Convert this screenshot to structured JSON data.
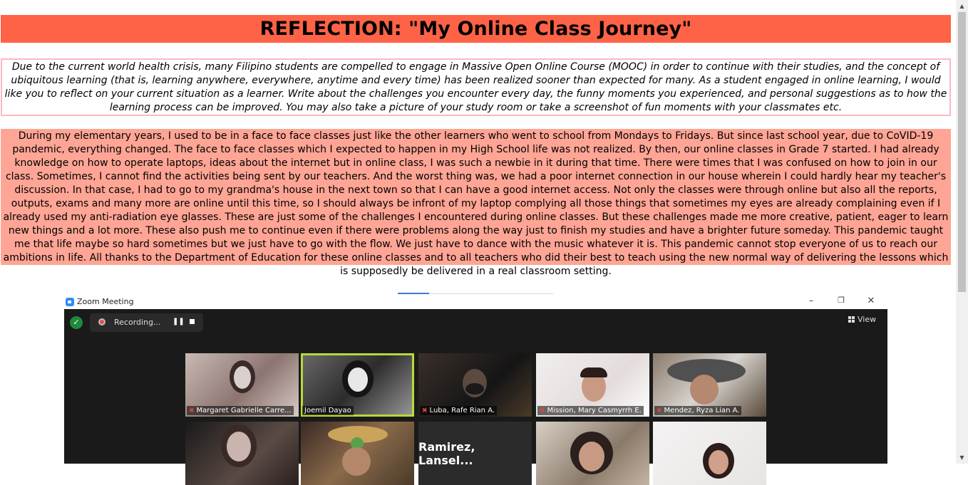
{
  "title": "REFLECTION: \"My Online Class Journey\"",
  "prompt": "Due to the current world health crisis, many Filipino students are compelled to engage in Massive Open Online Course (MOOC) in order to continue with their studies, and the concept of ubiquitous learning (that is, learning anywhere, everywhere, anytime and every time) has been realized sooner than expected for many. As a student engaged in online learning, I would like you to reflect on your current situation as a learner. Write about the challenges you encounter every day, the funny moments you experienced, and personal suggestions as to how the learning process can be improved. You may also take a picture of your study room or take a screenshot of fun moments with your classmates etc.",
  "response": "During my elementary years, I used to be in a face to face classes just like the other learners who went to school from Mondays to Fridays. But since last school year, due to CoVID-19 pandemic, everything changed. The face to face classes which I expected to happen in my High School life was not realized. By then, our online classes in Grade 7 started. I had already knowledge on how to operate laptops, ideas about the internet but in online class, I was such a newbie in it during that time. There were times that I was confused on how to join in our class. Sometimes, I cannot find the activities being sent by our teachers. And the worst thing was, we had a poor internet connection in our house wherein I could hardly hear my teacher's discussion. In that case, I had to go to my grandma's house in the next town so that I can have a good internet access. Not only the classes were through online but also all the reports, outputs, exams and many more are online until this time, so I should always be infront of my laptop complying all those things that sometimes my eyes are already complaining even if I already used my anti-radiation eye glasses. These are just some of the challenges I encountered during online classes. But these challenges made me more creative, patient, eager to learn new things and a lot more. These also push me to continue even if there were problems along the way just to finish my studies and have a brighter future someday. This pandemic taught me that life maybe so hard sometimes but we just have to go with the flow. We just have to dance with the music whatever it is. This pandemic cannot stop everyone of us to reach our ambitions in life. All thanks to the Department of Education for these online classes and to all teachers who did their best to teach using the new normal way of delivering the lessons which is supposedly be delivered in a real classroom setting.",
  "zoom": {
    "window_title": "Zoom Meeting",
    "recording_label": "Recording...",
    "view_label": "View",
    "participants": [
      {
        "name": "Margaret Gabrielle Carre...",
        "muted": true
      },
      {
        "name": "Joemil Dayao",
        "muted": false
      },
      {
        "name": "Luba, Rafe Rian A.",
        "muted": true
      },
      {
        "name": "Mission, Mary Casmyrrh E.",
        "muted": true
      },
      {
        "name": "Mendez, Ryza Lian A.",
        "muted": true
      },
      {
        "name": "Ramirez,  Lansel...",
        "muted": false
      }
    ]
  },
  "colors": {
    "title_bg": "#ff6347",
    "response_bg": "#ffa595",
    "prompt_border": "#ffb6c1",
    "active_speaker": "#b6d93a"
  }
}
